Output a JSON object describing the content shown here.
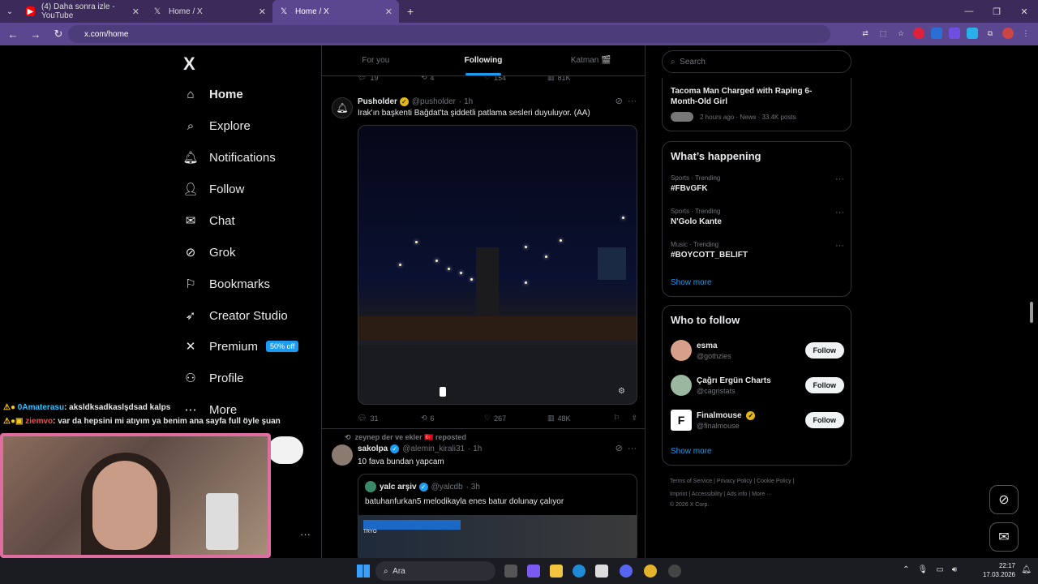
{
  "browser": {
    "tabs": [
      {
        "label": "(4) Daha sonra izle - YouTube",
        "icon": "youtube-icon",
        "active": false
      },
      {
        "label": "Home / X",
        "icon": "x-icon",
        "active": false
      },
      {
        "label": "Home / X",
        "icon": "x-icon",
        "active": true
      }
    ],
    "url": "x.com/home"
  },
  "leftnav": {
    "logo": "X",
    "items": [
      {
        "label": "Home",
        "icon": "home-icon",
        "bold": true
      },
      {
        "label": "Explore",
        "icon": "search-icon"
      },
      {
        "label": "Notifications",
        "icon": "bell-icon"
      },
      {
        "label": "Follow",
        "icon": "person-add-icon"
      },
      {
        "label": "Chat",
        "icon": "mail-icon"
      },
      {
        "label": "Grok",
        "icon": "grok-icon"
      },
      {
        "label": "Bookmarks",
        "icon": "bookmark-icon"
      },
      {
        "label": "Creator Studio",
        "icon": "rocket-icon"
      },
      {
        "label": "Premium",
        "icon": "x-icon",
        "badge": "50% off"
      },
      {
        "label": "Profile",
        "icon": "person-icon"
      },
      {
        "label": "More",
        "icon": "more-circle-icon"
      }
    ]
  },
  "stream_chat": [
    {
      "user": "0Amaterasu",
      "text": ": aksldksadkaslşdsad kalps"
    },
    {
      "user": "ziemvo",
      "text": ": var da hepsini mi atıyım ya benim ana sayfa full öyle şuan"
    }
  ],
  "feed": {
    "tabs": [
      "For you",
      "Following",
      "Katman 🎬"
    ],
    "active_tab": "Following",
    "prev_actions": {
      "replies": "19",
      "reposts": "4",
      "likes": "154",
      "views": "81K"
    },
    "post1": {
      "name": "Pusholder",
      "handle": "@pusholder",
      "time": "· 1h",
      "text": "Irak'ın başkenti Bağdat'ta şiddetli patlama sesleri duyuluyor. (AA)",
      "actions": {
        "replies": "31",
        "reposts": "6",
        "likes": "267",
        "views": "48K"
      }
    },
    "post2": {
      "repost_by": "zeynep der ve ekler 🇹🇷 reposted",
      "name": "sakolpa",
      "handle": "@alemin_kirali31",
      "time": "· 1h",
      "text": "10 fava bundan yapcam",
      "quote": {
        "name": "yalc arşiv",
        "handle": "@yalcdb",
        "time": "· 3h",
        "text": "batuhanfurkan5 melodikayla enes batur dolunay çalıyor",
        "overlay_label": "TRYO"
      }
    }
  },
  "rightcol": {
    "search_placeholder": "Search",
    "news": {
      "title": "Tacoma Man Charged with Raping 6-Month-Old Girl",
      "meta": "2 hours ago · News · 33.4K posts"
    },
    "happening": {
      "title": "What’s happening",
      "trends": [
        {
          "meta": "Sports · Trending",
          "name": "#FBvGFK"
        },
        {
          "meta": "Sports · Trending",
          "name": "N'Golo Kante"
        },
        {
          "meta": "Music · Trending",
          "name": "#BOYCOTT_BELIFT"
        }
      ],
      "show_more": "Show more"
    },
    "who_to_follow": {
      "title": "Who to follow",
      "accounts": [
        {
          "name": "esma",
          "handle": "@gothzies",
          "button": "Follow"
        },
        {
          "name": "Çağrı Ergün Charts",
          "handle": "@cagristats",
          "button": "Follow"
        },
        {
          "name": "Finalmouse",
          "handle": "@finalmouse",
          "button": "Follow"
        }
      ],
      "show_more": "Show more"
    },
    "footer": {
      "line1": "Terms of Service  |  Privacy Policy  |  Cookie Policy  |",
      "line2": "Imprint  |  Accessibility  |  Ads info  |  More ···",
      "line3": "© 2026 X Corp."
    }
  },
  "taskbar": {
    "search": "Ara",
    "time": "22:17",
    "date": "17.03.2026"
  },
  "colors": {
    "accent": "#1d9bf0",
    "browser_tab": "#5a4790"
  }
}
